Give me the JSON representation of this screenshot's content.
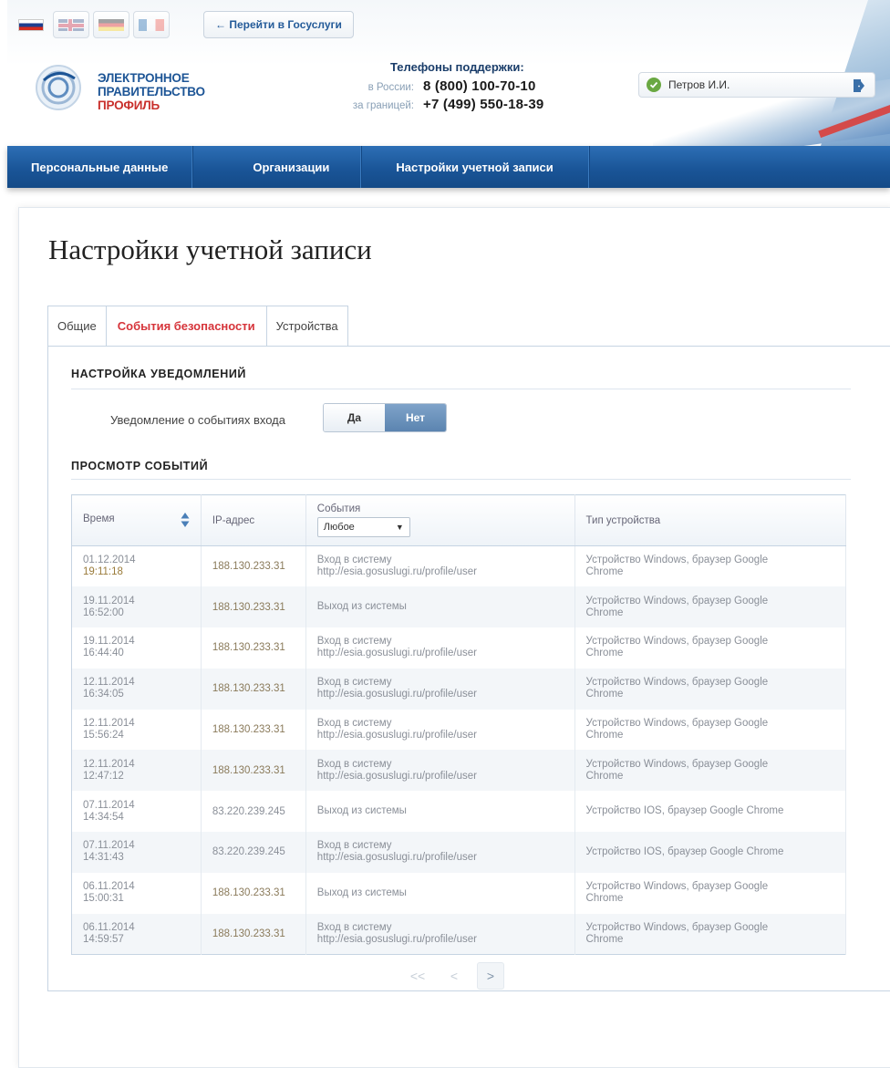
{
  "header": {
    "gosuslugi_link": "← Перейти в Госуслуги",
    "logo": {
      "line1": "ЭЛЕКТРОННОЕ",
      "line2": "ПРАВИТЕЛЬСТВО",
      "line3": "ПРОФИЛЬ"
    },
    "support": {
      "title": "Телефоны поддержки:",
      "russia_label": "в России:",
      "russia_phone": "8 (800) 100-70-10",
      "abroad_label": "за границей:",
      "abroad_phone": "+7 (499) 550-18-39"
    },
    "user_name": "Петров И.И.",
    "languages": [
      "ru",
      "en",
      "de",
      "fr"
    ]
  },
  "nav": {
    "items": [
      "Персональные данные",
      "Организации",
      "Настройки учетной записи"
    ]
  },
  "page": {
    "title": "Настройки учетной записи",
    "tabs": [
      "Общие",
      "События безопасности",
      "Устройства"
    ],
    "active_tab": "События безопасности"
  },
  "notifications": {
    "section_title": "НАСТРОЙКА УВЕДОМЛЕНИЙ",
    "label": "Уведомление о событиях входа",
    "yes": "Да",
    "no": "Нет",
    "selected": "Нет"
  },
  "events": {
    "section_title": "ПРОСМОТР СОБЫТИЙ",
    "columns": {
      "time": "Время",
      "ip": "IP-адрес",
      "event": "События",
      "device": "Тип устройства"
    },
    "filter_value": "Любое",
    "rows": [
      {
        "date": "01.12.2014",
        "time": "19:11:18",
        "ip": "188.130.233.31",
        "event1": "Вход в систему",
        "event2": "http://esia.gosuslugi.ru/profile/user",
        "device1": "Устройство Windows, браузер Google",
        "device2": "Chrome"
      },
      {
        "date": "19.11.2014",
        "time": "16:52:00",
        "ip": "188.130.233.31",
        "event1": "Выход из системы",
        "event2": "",
        "device1": "Устройство Windows, браузер Google",
        "device2": "Chrome"
      },
      {
        "date": "19.11.2014",
        "time": "16:44:40",
        "ip": "188.130.233.31",
        "event1": "Вход в систему",
        "event2": "http://esia.gosuslugi.ru/profile/user",
        "device1": "Устройство Windows, браузер Google",
        "device2": "Chrome"
      },
      {
        "date": "12.11.2014",
        "time": "16:34:05",
        "ip": "188.130.233.31",
        "event1": "Вход в систему",
        "event2": "http://esia.gosuslugi.ru/profile/user",
        "device1": "Устройство Windows, браузер Google",
        "device2": "Chrome"
      },
      {
        "date": "12.11.2014",
        "time": "15:56:24",
        "ip": "188.130.233.31",
        "event1": "Вход в систему",
        "event2": "http://esia.gosuslugi.ru/profile/user",
        "device1": "Устройство Windows, браузер Google",
        "device2": "Chrome"
      },
      {
        "date": "12.11.2014",
        "time": "12:47:12",
        "ip": "188.130.233.31",
        "event1": "Вход в систему",
        "event2": "http://esia.gosuslugi.ru/profile/user",
        "device1": "Устройство Windows, браузер Google",
        "device2": "Chrome"
      },
      {
        "date": "07.11.2014",
        "time": "14:34:54",
        "ip": "83.220.239.245",
        "event1": "Выход из системы",
        "event2": "",
        "device1": "Устройство IOS, браузер Google Chrome",
        "device2": ""
      },
      {
        "date": "07.11.2014",
        "time": "14:31:43",
        "ip": "83.220.239.245",
        "event1": "Вход в систему",
        "event2": "http://esia.gosuslugi.ru/profile/user",
        "device1": "Устройство IOS, браузер Google Chrome",
        "device2": ""
      },
      {
        "date": "06.11.2014",
        "time": "15:00:31",
        "ip": "188.130.233.31",
        "event1": "Выход из системы",
        "event2": "",
        "device1": "Устройство Windows, браузер Google",
        "device2": "Chrome"
      },
      {
        "date": "06.11.2014",
        "time": "14:59:57",
        "ip": "188.130.233.31",
        "event1": "Вход в систему",
        "event2": "http://esia.gosuslugi.ru/profile/user",
        "device1": "Устройство Windows, браузер Google",
        "device2": "Chrome"
      }
    ]
  },
  "pager": {
    "first": "<<",
    "prev": "<",
    "next": ">"
  },
  "colors": {
    "nav_blue": "#1a5598",
    "accent_red": "#d6343a",
    "logo_blue": "#1d5596",
    "online_green": "#6aa842"
  }
}
